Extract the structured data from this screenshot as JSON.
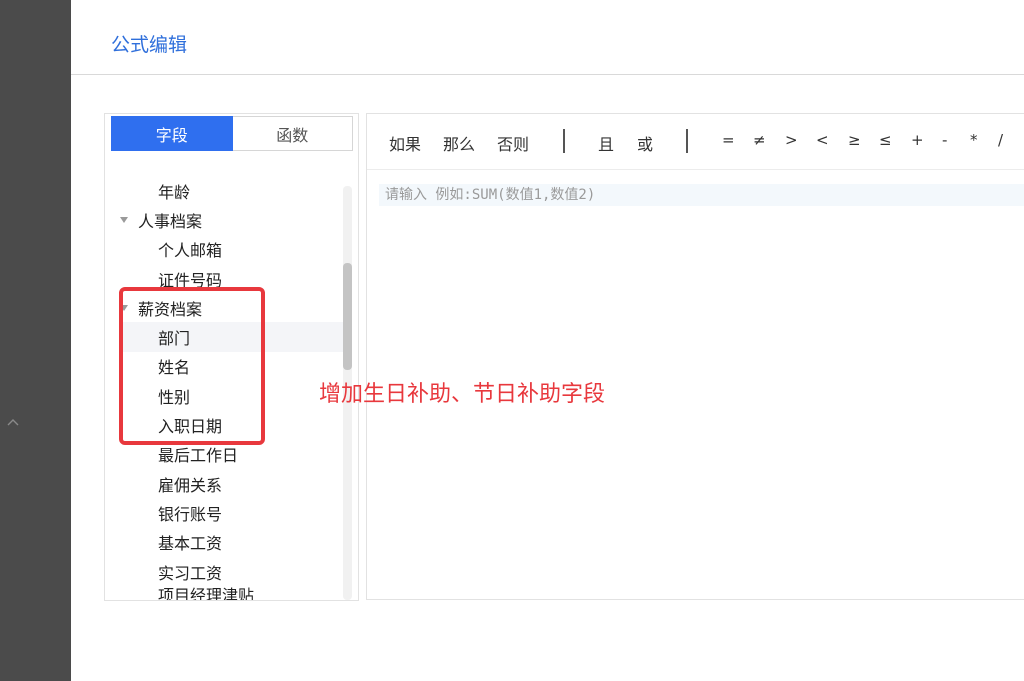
{
  "dialog": {
    "title": "公式编辑"
  },
  "tabs": [
    {
      "label": "字段",
      "active": true
    },
    {
      "label": "函数",
      "active": false
    }
  ],
  "tree": [
    {
      "label": "年龄",
      "level": "leaf"
    },
    {
      "label": "人事档案",
      "level": "group",
      "expanded": true
    },
    {
      "label": "个人邮箱",
      "level": "leaf"
    },
    {
      "label": "证件号码",
      "level": "leaf"
    },
    {
      "label": "薪资档案",
      "level": "group",
      "expanded": true
    },
    {
      "label": "部门",
      "level": "leaf",
      "hovered": true
    },
    {
      "label": "姓名",
      "level": "leaf"
    },
    {
      "label": "性别",
      "level": "leaf"
    },
    {
      "label": "入职日期",
      "level": "leaf"
    },
    {
      "label": "最后工作日",
      "level": "leaf"
    },
    {
      "label": "雇佣关系",
      "level": "leaf"
    },
    {
      "label": "银行账号",
      "level": "leaf"
    },
    {
      "label": "基本工资",
      "level": "leaf"
    },
    {
      "label": "实习工资",
      "level": "leaf"
    },
    {
      "label": "项目经理津贴",
      "level": "leaf"
    }
  ],
  "toolbar": {
    "if": "如果",
    "then": "那么",
    "else": "否则",
    "and": "且",
    "or": "或",
    "operators": [
      "=",
      "≠",
      ">",
      "<",
      "≥",
      "≤",
      "+",
      "-",
      "*",
      "/"
    ]
  },
  "editor": {
    "placeholder": "请输入 例如:SUM(数值1,数值2)",
    "value": ""
  },
  "annotation": {
    "text": "增加生日补助、节日补助字段",
    "color": "#e8383d"
  },
  "colors": {
    "accent": "#2f6fef",
    "title": "#2f6fdb",
    "rail": "#4b4b4b"
  }
}
